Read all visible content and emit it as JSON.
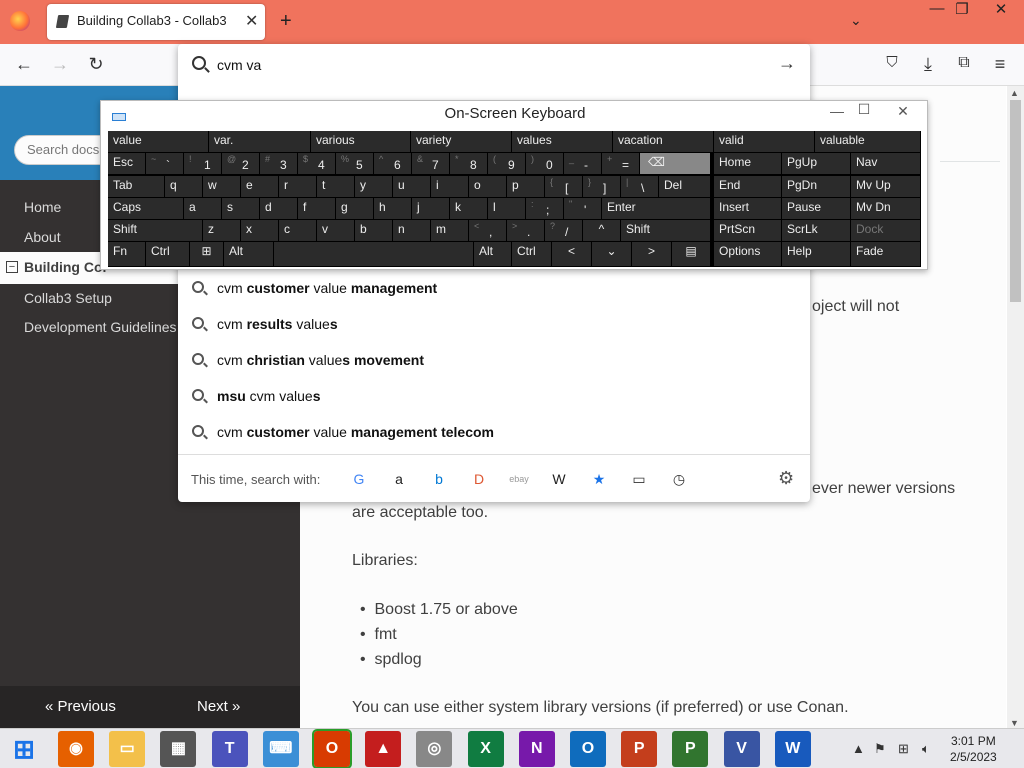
{
  "tabs": [
    {
      "title": "Building Collab3 - Collab3",
      "active": true
    }
  ],
  "urlbar": {
    "value": "cvm va"
  },
  "suggestions": [
    {
      "parts": [
        [
          "cvm ",
          false
        ],
        [
          "customer",
          true
        ],
        [
          " value ",
          false
        ],
        [
          "management",
          true
        ]
      ]
    },
    {
      "parts": [
        [
          "cvm ",
          false
        ],
        [
          "results",
          true
        ],
        [
          " value",
          false
        ],
        [
          "s",
          true
        ]
      ]
    },
    {
      "parts": [
        [
          "cvm ",
          false
        ],
        [
          "christian",
          true
        ],
        [
          " value",
          false
        ],
        [
          "s movement",
          true
        ]
      ]
    },
    {
      "parts": [
        [
          "msu",
          true
        ],
        [
          " cvm value",
          false
        ],
        [
          "s",
          true
        ]
      ]
    },
    {
      "parts": [
        [
          "cvm ",
          false
        ],
        [
          "customer",
          true
        ],
        [
          " value ",
          false
        ],
        [
          "management telecom",
          true
        ]
      ]
    }
  ],
  "search_with": "This time, search with:",
  "engines": [
    "google-icon",
    "amazon-icon",
    "bing-icon",
    "duckduckgo-icon",
    "ebay-icon",
    "wikipedia-icon",
    "bookmarks-icon",
    "tabs-icon",
    "history-icon"
  ],
  "engine_glyphs": [
    "G",
    "a",
    "b",
    "D",
    "ebay",
    "W",
    "★",
    "▭",
    "◷"
  ],
  "sidebar": {
    "search_placeholder": "Search docs",
    "items": [
      "Home",
      "About"
    ],
    "current": "Building Col",
    "sub_items": [
      "Collab3 Setup",
      "Development Guidelines"
    ],
    "prev": "« Previous",
    "next": "Next »"
  },
  "content": {
    "frag1": "oject will not",
    "frag2": "ever newer versions",
    "frag3": "are acceptable too.",
    "libraries": "Libraries:",
    "libs": [
      "Boost 1.75 or above",
      "fmt",
      "spdlog"
    ],
    "conan": "You can use either system library versions (if preferred) or use Conan."
  },
  "osk": {
    "title": "On-Screen Keyboard",
    "predictions": [
      "value",
      "var.",
      "various",
      "variety",
      "values",
      "vacation",
      "valid",
      "valuable"
    ],
    "row1": [
      [
        "~",
        "`"
      ],
      [
        "!",
        "1"
      ],
      [
        "@",
        "2"
      ],
      [
        "#",
        "3"
      ],
      [
        "$",
        "4"
      ],
      [
        "%",
        "5"
      ],
      [
        "^",
        "6"
      ],
      [
        "&",
        "7"
      ],
      [
        "*",
        "8"
      ],
      [
        "(",
        "9"
      ],
      [
        ")",
        "0"
      ],
      [
        "_",
        "-"
      ],
      [
        "+",
        "="
      ]
    ],
    "row2": [
      "q",
      "w",
      "e",
      "r",
      "t",
      "y",
      "u",
      "i",
      "o",
      "p"
    ],
    "row2b": [
      [
        "{",
        "["
      ],
      [
        "}",
        "]"
      ],
      [
        "|",
        "\\"
      ]
    ],
    "row3": [
      "a",
      "s",
      "d",
      "f",
      "g",
      "h",
      "j",
      "k",
      "l"
    ],
    "row3b": [
      [
        ":",
        ";"
      ],
      [
        "\"",
        "'"
      ]
    ],
    "row4": [
      "z",
      "x",
      "c",
      "v",
      "b",
      "n",
      "m"
    ],
    "row4b": [
      [
        "<",
        ","
      ],
      [
        ">",
        "."
      ],
      [
        "?",
        "/"
      ]
    ],
    "labels": {
      "esc": "Esc",
      "tab": "Tab",
      "caps": "Caps",
      "shift": "Shift",
      "fn": "Fn",
      "ctrl": "Ctrl",
      "alt": "Alt",
      "enter": "Enter",
      "del": "Del",
      "home": "Home",
      "pgup": "PgUp",
      "nav": "Nav",
      "end": "End",
      "pgdn": "PgDn",
      "mvup": "Mv Up",
      "insert": "Insert",
      "pause": "Pause",
      "mvdn": "Mv Dn",
      "prtscn": "PrtScn",
      "scrlk": "ScrLk",
      "dock": "Dock",
      "options": "Options",
      "help": "Help",
      "fade": "Fade"
    }
  },
  "clock": {
    "time": "3:01 PM",
    "date": "2/5/2023"
  },
  "taskbar_apps": [
    "start-icon",
    "firefox-icon",
    "file-explorer-icon",
    "network-icon",
    "teams-icon",
    "osk-icon",
    "office-icon",
    "acrobat-icon",
    "media-icon",
    "excel-icon",
    "onenote-icon",
    "outlook-icon",
    "powerpoint-icon",
    "project-icon",
    "visio-icon",
    "word-icon"
  ],
  "colors": {
    "tabstrip": "#f0735d",
    "sidebar": "#343131",
    "sidebar_top": "#2980b9",
    "osk_key": "#2b2b2b"
  }
}
